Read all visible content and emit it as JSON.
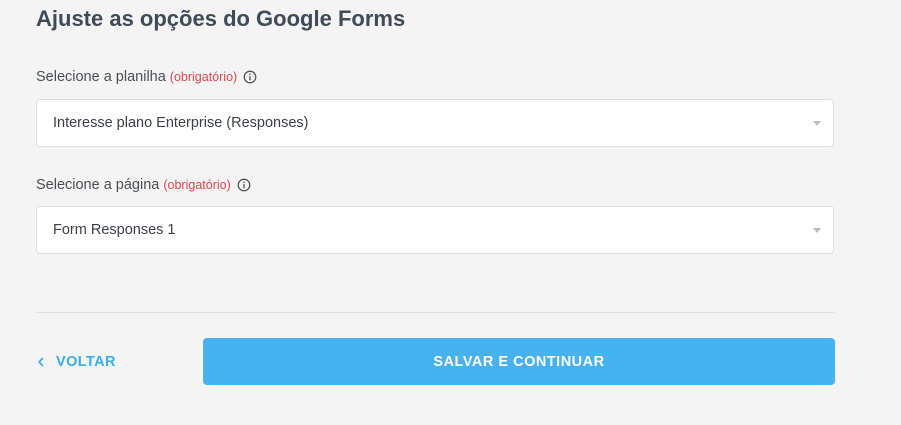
{
  "header": {
    "title": "Ajuste as opções do Google Forms"
  },
  "fields": [
    {
      "label": "Selecione a planilha",
      "required_text": "(obrigatório)",
      "selected_value": "Interesse plano Enterprise (Responses)",
      "info_icon": "info-icon",
      "caret_icon": "caret-down-icon"
    },
    {
      "label": "Selecione a página",
      "required_text": "(obrigatório)",
      "selected_value": "Form Responses 1",
      "info_icon": "info-icon",
      "caret_icon": "caret-down-icon"
    }
  ],
  "footer": {
    "back_label": "VOLTAR",
    "back_icon": "chevron-left-icon",
    "save_label": "SALVAR E CONTINUAR"
  },
  "colors": {
    "background": "#f4f4f4",
    "title": "#3f4a5b",
    "required": "#e0454f",
    "accent": "#47b2f0",
    "back_link": "#3aaee6"
  }
}
